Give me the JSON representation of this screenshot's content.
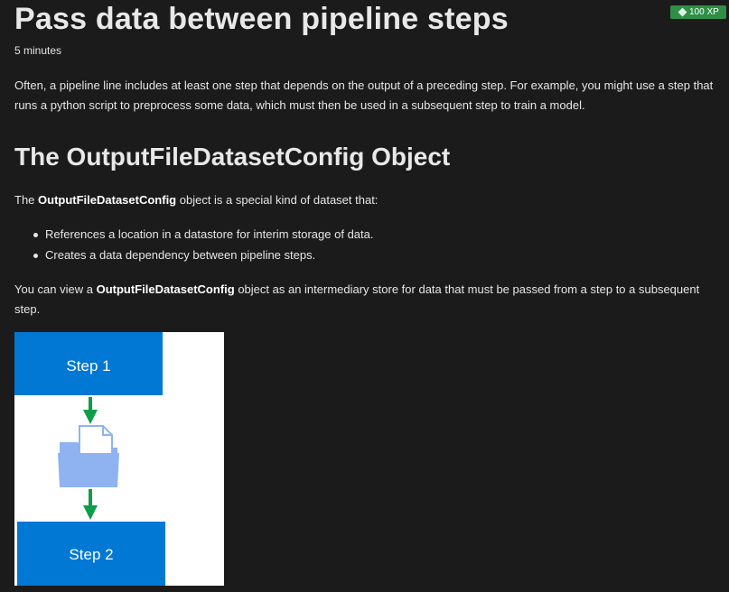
{
  "header": {
    "title": "Pass data between pipeline steps",
    "xp_badge": "100 XP",
    "duration": "5 minutes"
  },
  "intro": {
    "text": "Often, a pipeline line includes at least one step that depends on the output of a preceding step. For example, you might use a step that runs a python script to preprocess some data, which must then be used in a subsequent step to train a model."
  },
  "section": {
    "heading": "The OutputFileDatasetConfig Object",
    "obj_para_prefix": "The ",
    "obj_para_bold": "OutputFileDatasetConfig",
    "obj_para_suffix": " object is a special kind of dataset that:",
    "bullets": [
      "References a location in a datastore for interim storage of data.",
      "Creates a data dependency between pipeline steps."
    ],
    "view_para_prefix": "You can view a ",
    "view_para_bold": "OutputFileDatasetConfig",
    "view_para_suffix": " object as an intermediary store for data that must be passed from a step to a subsequent step."
  },
  "diagram": {
    "step1_label": "Step 1",
    "step2_label": "Step 2",
    "icons": [
      "down-arrow-icon",
      "folder-document-icon"
    ],
    "colors": {
      "step_box": "#0078d4",
      "arrow": "#0f9d48",
      "folder": "#8fb3f0",
      "document": "#ffffff",
      "document_outline": "#8fb3f0"
    }
  },
  "colors": {
    "background": "#1b1b1b",
    "text": "#e6e6e6",
    "xp_badge": "#2f8f46"
  }
}
